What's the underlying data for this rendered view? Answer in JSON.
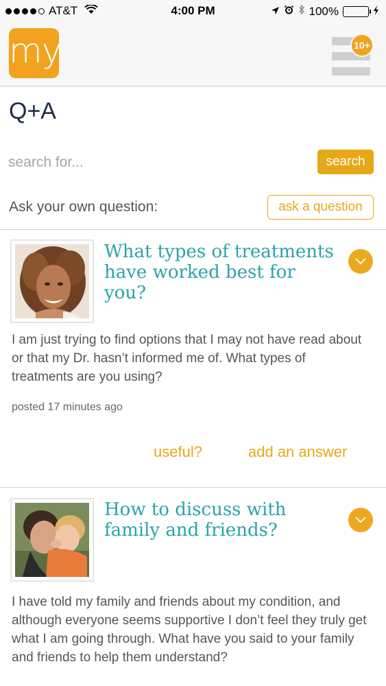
{
  "status_bar": {
    "carrier": "AT&T",
    "time": "4:00 PM",
    "battery": "100%",
    "battery_fill": 1.0
  },
  "header": {
    "logo_text": "my",
    "notification_badge": "10+"
  },
  "page": {
    "title": "Q+A"
  },
  "search": {
    "placeholder": "search for...",
    "button_label": "search"
  },
  "ask": {
    "label": "Ask your own question:",
    "button_label": "ask a question"
  },
  "questions": [
    {
      "title": "What types of treatments have worked best for you?",
      "body": "I am just trying to find options that I may not have read about or that my Dr. hasn’t informed me of. What types of treatments are you using?",
      "posted": "posted 17 minutes ago",
      "useful_label": "useful?",
      "answer_label": "add an answer"
    },
    {
      "title": "How to discuss with family and friends?",
      "body": "I have told my family and friends about my condition, and although everyone seems supportive I don’t feel they truly get what I am going through.  What have you said to your family and friends to help them understand?"
    }
  ],
  "colors": {
    "accent": "#e6a819",
    "teal": "#2aa3a9",
    "navy": "#1e2a44"
  }
}
